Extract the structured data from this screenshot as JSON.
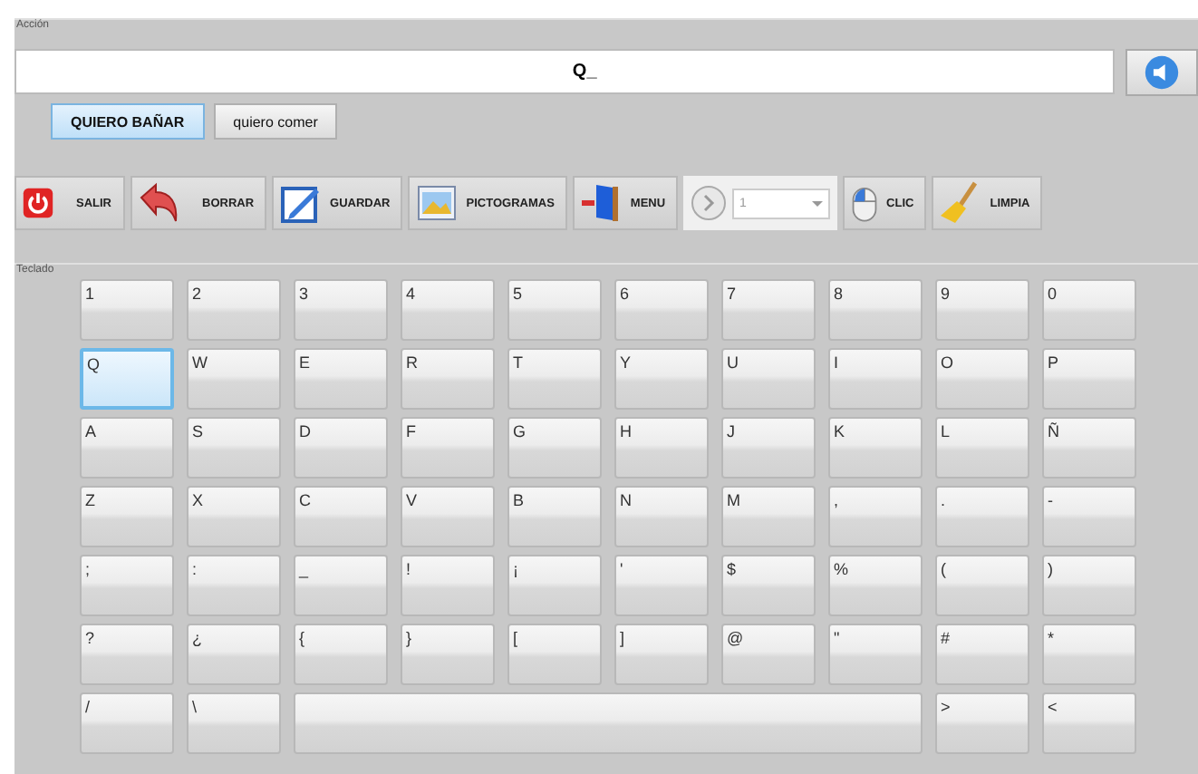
{
  "accion": {
    "label": "Acción",
    "text": "Q_"
  },
  "phrases": [
    {
      "label": "QUIERO BAÑAR",
      "selected": true
    },
    {
      "label": "quiero comer",
      "selected": false
    }
  ],
  "toolbar": [
    {
      "kind": "button",
      "label": "SALIR"
    },
    {
      "kind": "button",
      "label": "BORRAR"
    },
    {
      "kind": "button",
      "label": "GUARDAR"
    },
    {
      "kind": "button",
      "label": "PICTOGRAMAS"
    },
    {
      "kind": "button",
      "label": "MENU"
    },
    {
      "kind": "selector",
      "value": "1"
    },
    {
      "kind": "button",
      "label": "CLIC"
    },
    {
      "kind": "button",
      "label": "LIMPIA"
    }
  ],
  "teclado": {
    "label": "Teclado",
    "rows": [
      [
        {
          "label": "1",
          "selected": false
        },
        {
          "label": "2",
          "selected": false
        },
        {
          "label": "3",
          "selected": false
        },
        {
          "label": "4",
          "selected": false
        },
        {
          "label": "5",
          "selected": false
        },
        {
          "label": "6",
          "selected": false
        },
        {
          "label": "7",
          "selected": false
        },
        {
          "label": "8",
          "selected": false
        },
        {
          "label": "9",
          "selected": false
        },
        {
          "label": "0",
          "selected": false
        }
      ],
      [
        {
          "label": "Q",
          "selected": true
        },
        {
          "label": "W",
          "selected": false
        },
        {
          "label": "E",
          "selected": false
        },
        {
          "label": "R",
          "selected": false
        },
        {
          "label": "T",
          "selected": false
        },
        {
          "label": "Y",
          "selected": false
        },
        {
          "label": "U",
          "selected": false
        },
        {
          "label": "I",
          "selected": false
        },
        {
          "label": "O",
          "selected": false
        },
        {
          "label": "P",
          "selected": false
        }
      ],
      [
        {
          "label": "A",
          "selected": false
        },
        {
          "label": "S",
          "selected": false
        },
        {
          "label": "D",
          "selected": false
        },
        {
          "label": "F",
          "selected": false
        },
        {
          "label": "G",
          "selected": false
        },
        {
          "label": "H",
          "selected": false
        },
        {
          "label": "J",
          "selected": false
        },
        {
          "label": "K",
          "selected": false
        },
        {
          "label": "L",
          "selected": false
        },
        {
          "label": "Ñ",
          "selected": false
        }
      ],
      [
        {
          "label": "Z",
          "selected": false
        },
        {
          "label": "X",
          "selected": false
        },
        {
          "label": "C",
          "selected": false
        },
        {
          "label": "V",
          "selected": false
        },
        {
          "label": "B",
          "selected": false
        },
        {
          "label": "N",
          "selected": false
        },
        {
          "label": "M",
          "selected": false
        },
        {
          "label": ",",
          "selected": false
        },
        {
          "label": ".",
          "selected": false
        },
        {
          "label": "-",
          "selected": false
        }
      ],
      [
        {
          "label": ";",
          "selected": false
        },
        {
          "label": ":",
          "selected": false
        },
        {
          "label": "_",
          "selected": false
        },
        {
          "label": "!",
          "selected": false
        },
        {
          "label": "¡",
          "selected": false
        },
        {
          "label": "'",
          "selected": false
        },
        {
          "label": "$",
          "selected": false
        },
        {
          "label": "%",
          "selected": false
        },
        {
          "label": "(",
          "selected": false
        },
        {
          "label": ")",
          "selected": false
        }
      ],
      [
        {
          "label": "?",
          "selected": false
        },
        {
          "label": "¿",
          "selected": false
        },
        {
          "label": "{",
          "selected": false
        },
        {
          "label": "}",
          "selected": false
        },
        {
          "label": "[",
          "selected": false
        },
        {
          "label": "]",
          "selected": false
        },
        {
          "label": "@",
          "selected": false
        },
        {
          "label": "\"",
          "selected": false
        },
        {
          "label": "#",
          "selected": false
        },
        {
          "label": "*",
          "selected": false
        }
      ]
    ],
    "bottom_row": [
      {
        "kind": "key",
        "label": "/",
        "selected": false
      },
      {
        "kind": "key",
        "label": "\\",
        "selected": false
      },
      {
        "kind": "space",
        "selected": false
      },
      {
        "kind": "key",
        "label": ">",
        "selected": false
      },
      {
        "kind": "key",
        "label": "<",
        "selected": false
      }
    ]
  }
}
